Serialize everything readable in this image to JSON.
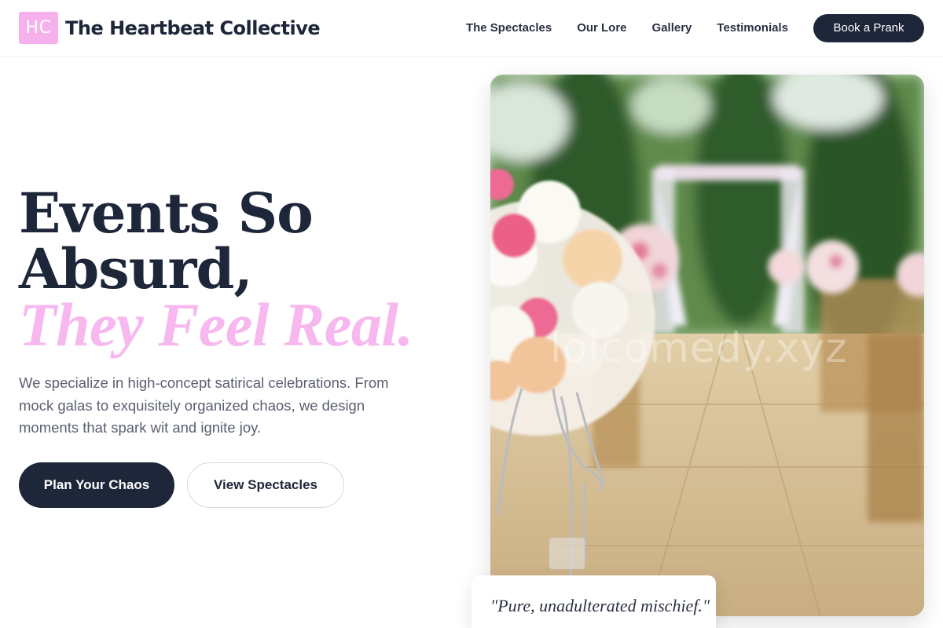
{
  "brand": {
    "logo_initials": "HC",
    "name": "The Heartbeat Collective"
  },
  "nav": {
    "links": [
      "The Spectacles",
      "Our Lore",
      "Gallery",
      "Testimonials"
    ],
    "cta_label": "Book a Prank"
  },
  "hero": {
    "headline_line1": "Events So",
    "headline_line2": "Absurd,",
    "headline_accent": "They Feel Real.",
    "lead": "We specialize in high-concept satirical celebrations. From mock galas to exquisitely organized chaos, we design moments that spark wit and ignite joy.",
    "primary_cta": "Plan Your Chaos",
    "secondary_cta": "View Spectacles",
    "image_watermark": "lolcomedy.xyz",
    "quote": "\"Pure, unadulterated mischief.\""
  },
  "colors": {
    "navy": "#1e2639",
    "accent_pink": "#f7b8f0",
    "text_gray": "#5b6070"
  }
}
